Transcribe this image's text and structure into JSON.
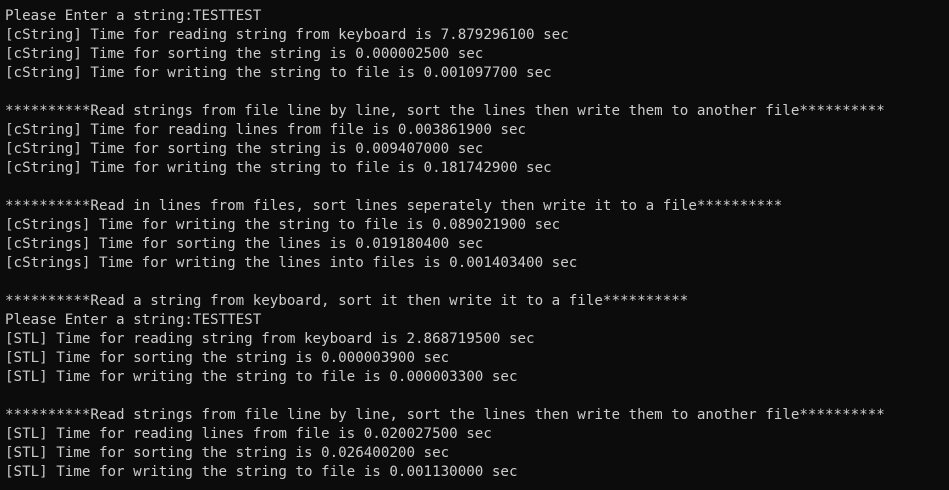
{
  "terminal": {
    "lines": [
      "Please Enter a string:TESTTEST",
      "[cString] Time for reading string from keyboard is 7.879296100 sec",
      "[cString] Time for sorting the string is 0.000002500 sec",
      "[cString] Time for writing the string to file is 0.001097700 sec",
      "",
      "**********Read strings from file line by line, sort the lines then write them to another file**********",
      "[cString] Time for reading lines from file is 0.003861900 sec",
      "[cString] Time for sorting the string is 0.009407000 sec",
      "[cString] Time for writing the string to file is 0.181742900 sec",
      "",
      "**********Read in lines from files, sort lines seperately then write it to a file**********",
      "[cStrings] Time for writing the string to file is 0.089021900 sec",
      "[cStrings] Time for sorting the lines is 0.019180400 sec",
      "[cStrings] Time for writing the lines into files is 0.001403400 sec",
      "",
      "**********Read a string from keyboard, sort it then write it to a file**********",
      "Please Enter a string:TESTTEST",
      "[STL] Time for reading string from keyboard is 2.868719500 sec",
      "[STL] Time for sorting the string is 0.000003900 sec",
      "[STL] Time for writing the string to file is 0.000003300 sec",
      "",
      "**********Read strings from file line by line, sort the lines then write them to another file**********",
      "[STL] Time for reading lines from file is 0.020027500 sec",
      "[STL] Time for sorting the string is 0.026400200 sec",
      "[STL] Time for writing the string to file is 0.001130000 sec"
    ]
  },
  "colors": {
    "background": "#0c0c0c",
    "foreground": "#cccccc"
  }
}
